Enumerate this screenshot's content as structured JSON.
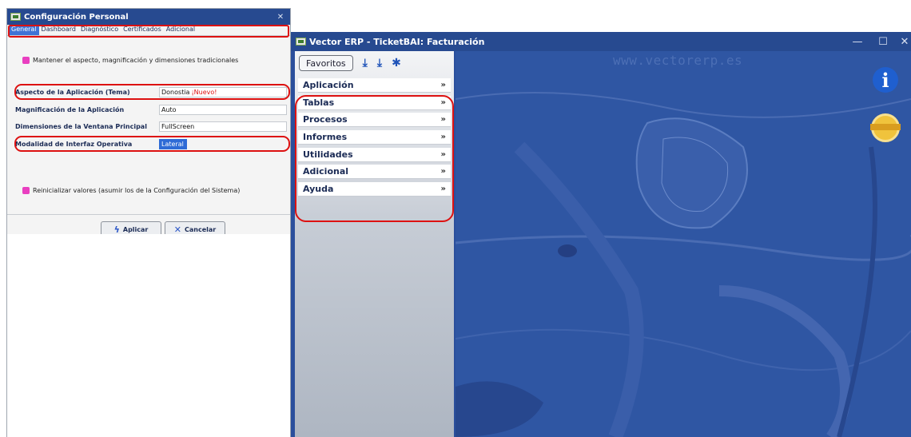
{
  "main_window": {
    "title": "Vector ERP - TicketBAI: Facturación",
    "controls": {
      "minimize": "—",
      "maximize": "☐",
      "close": "✕"
    }
  },
  "toolbar": {
    "favorites_label": "Favoritos",
    "icons": [
      "download-icon",
      "download-alt-icon",
      "tools-icon"
    ]
  },
  "accordion": {
    "items": [
      {
        "label": "Aplicación"
      },
      {
        "label": "Tablas"
      },
      {
        "label": "Procesos"
      },
      {
        "label": "Informes"
      },
      {
        "label": "Utilidades"
      },
      {
        "label": "Adicional"
      },
      {
        "label": "Ayuda"
      }
    ],
    "chevron": "»"
  },
  "desktop": {
    "watermark": "www.vectorerp.es",
    "info_glyph": "i"
  },
  "config_dialog": {
    "title": "Configuración Personal",
    "tabs": [
      "General",
      "Dashboard",
      "Diagnóstico",
      "Certificados",
      "Adicional"
    ],
    "active_tab": "General",
    "keep_traditional_label": "Mantener el aspecto, magnificación y dimensiones tradicionales",
    "fields": [
      {
        "label": "Aspecto de la Aplicación (Tema)",
        "value": "Donostia",
        "badge": "¡Nuevo!"
      },
      {
        "label": "Magnificación de la Aplicación",
        "value": "Auto"
      },
      {
        "label": "Dimensiones de la Ventana Principal",
        "value": "FullScreen"
      },
      {
        "label": "Modalidad de Interfaz Operativa",
        "value": "Lateral"
      }
    ],
    "reset_label": "Reinicializar valores (asumir los de la Configuración del Sistema)",
    "apply_label": "Aplicar",
    "cancel_label": "Cancelar"
  },
  "colors": {
    "title_bar": "#274a90",
    "desktop": "#2f56a3",
    "highlight_ring": "#dd1111",
    "checkbox": "#e93fc0"
  }
}
